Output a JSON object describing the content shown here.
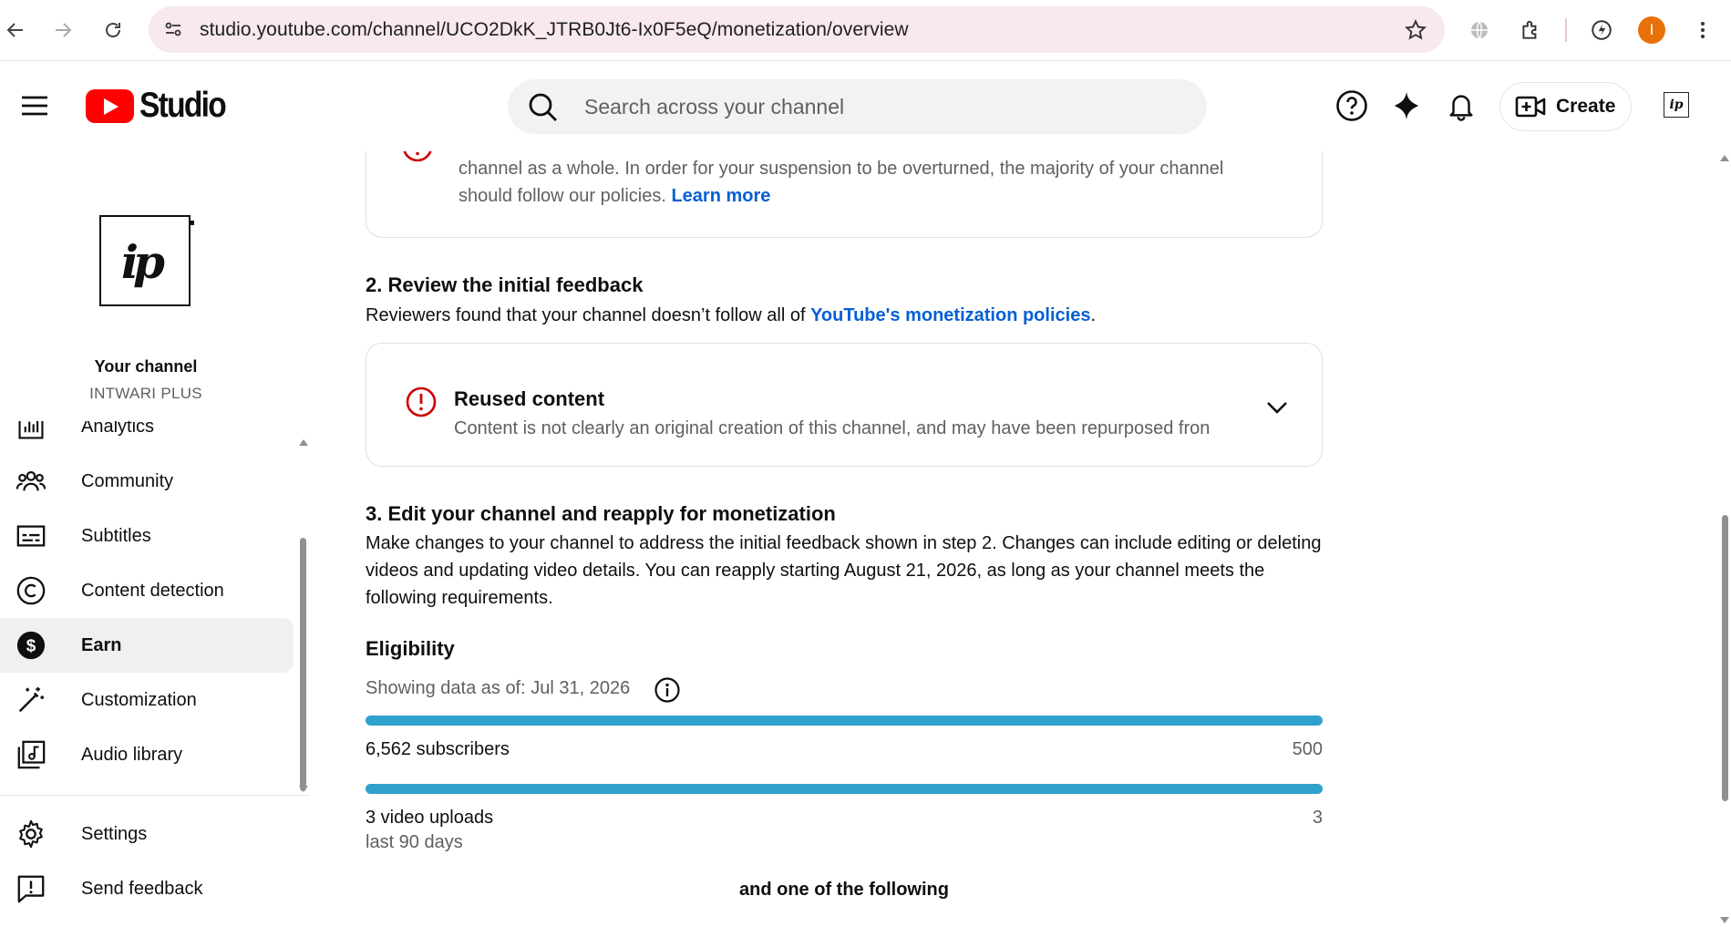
{
  "browser": {
    "url": "studio.youtube.com/channel/UCO2DkK_JTRB0Jt6-Ix0F5eQ/monetization/overview",
    "profile_initial": "I",
    "profile_color": "#e8710a"
  },
  "header": {
    "logo_text": "Studio",
    "search_placeholder": "Search across your channel",
    "create_label": "Create",
    "avatar_text": "ip"
  },
  "sidebar": {
    "avatar_text": "ip",
    "your_channel_label": "Your channel",
    "channel_name": "INTWARI PLUS",
    "items": [
      {
        "label": "Analytics",
        "icon": "analytics-icon"
      },
      {
        "label": "Community",
        "icon": "community-icon"
      },
      {
        "label": "Subtitles",
        "icon": "subtitles-icon"
      },
      {
        "label": "Content detection",
        "icon": "copyright-icon"
      },
      {
        "label": "Earn",
        "icon": "dollar-icon",
        "active": true
      },
      {
        "label": "Customization",
        "icon": "magic-wand-icon"
      },
      {
        "label": "Audio library",
        "icon": "audio-library-icon"
      }
    ],
    "footer_items": [
      {
        "label": "Settings",
        "icon": "gear-icon"
      },
      {
        "label": "Send feedback",
        "icon": "feedback-icon"
      }
    ]
  },
  "main": {
    "suspension_card": {
      "line1": "channel as a whole. In order for your suspension to be overturned, the majority of your channel",
      "line2_prefix": "should follow our policies. ",
      "learn_more": "Learn more"
    },
    "step2": {
      "title": "2. Review the initial feedback",
      "body_prefix": "Reviewers found that your channel doesn’t follow all of ",
      "link": "YouTube's monetization policies",
      "body_suffix": "."
    },
    "feedback_card": {
      "title": "Reused content",
      "description": "Content is not clearly an original creation of this channel, and may have been repurposed fron"
    },
    "step3": {
      "title": "3. Edit your channel and reapply for monetization",
      "body": "Make changes to your channel to address the initial feedback shown in step 2. Changes can include editing or deleting videos and updating video details. You can reapply starting August 21, 2026, as long as your channel meets the following requirements."
    },
    "eligibility": {
      "title": "Eligibility",
      "data_as_of": "Showing data as of: Jul 31, 2026",
      "bar_color": "#2fa1cc",
      "metrics": [
        {
          "label": "6,562 subscribers",
          "target": "500",
          "progress": 1.0
        },
        {
          "label": "3 video uploads",
          "sublabel": "last 90 days",
          "target": "3",
          "progress": 1.0
        }
      ],
      "footer": "and one of the following"
    }
  }
}
